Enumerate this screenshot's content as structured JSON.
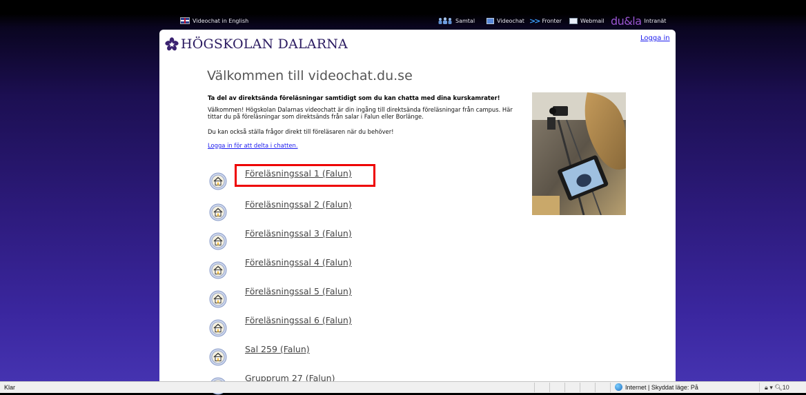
{
  "topnav": {
    "english": "Videochat in English",
    "samtal": "Samtal",
    "videochat": "Videochat",
    "fronter": "Fronter",
    "webmail": "Webmail",
    "dula": "du&la",
    "intranat": "Intranät"
  },
  "header": {
    "logo_text": "HÖGSKOLAN DALARNA",
    "login": "Logga in"
  },
  "main": {
    "heading": "Välkommen till videochat.du.se",
    "lead": "Ta del av direktsända föreläsningar samtidigt som du kan chatta med dina kurskamrater!",
    "para1": "Välkommen! Högskolan Dalarnas videochatt är din ingång till direktsända föreläsningar från campus. Här tittar du på föreläsningar som direktsänds från salar i Falun eller Borlänge.",
    "para2": "Du kan också ställa frågor direkt till föreläsaren när du behöver!",
    "login_link": "Logga in för att delta i chatten.",
    "rooms": [
      "Föreläsningssal 1 (Falun)",
      "Föreläsningssal 2 (Falun)",
      "Föreläsningssal 3 (Falun)",
      "Föreläsningssal 4 (Falun)",
      "Föreläsningssal 5 (Falun)",
      "Föreläsningssal 6 (Falun)",
      "Sal 259 (Falun)",
      "Grupprum 27 (Falun)"
    ]
  },
  "statusbar": {
    "status": "Klar",
    "zone": "Internet | Skyddat läge: På",
    "zoom": "10"
  }
}
